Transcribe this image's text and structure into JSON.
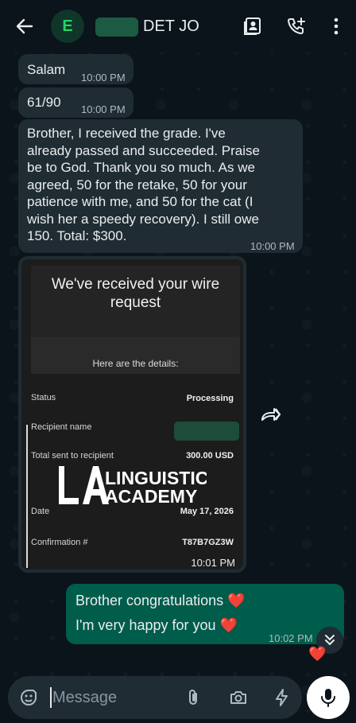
{
  "header": {
    "avatar_letter": "E",
    "contact_name": "DET JO",
    "back_icon": "arrow-left-icon",
    "icons": [
      "contact-card-icon",
      "add-call-icon",
      "more-vert-icon"
    ]
  },
  "messages": [
    {
      "text": "Salam",
      "time": "10:00 PM",
      "direction": "incoming"
    },
    {
      "text": "61/90",
      "time": "10:00 PM",
      "direction": "incoming"
    },
    {
      "lines": [
        "Brother, I received the grade. I've",
        "already passed and succeeded. Praise",
        "be to God. Thank you so much. As we",
        "agreed, 50 for the retake, 50 for your",
        "patience with me, and 50 for the cat (I",
        "wish her a speedy recovery). I still owe",
        "150. Total: $300."
      ],
      "time": "10:00 PM",
      "direction": "incoming"
    }
  ],
  "wire_receipt": {
    "title_line1": "We've received your wire",
    "title_line2": "request",
    "subtitle": "Here are the details:",
    "rows": [
      {
        "label": "Status",
        "value": "Processing"
      },
      {
        "label": "Recipient name",
        "value": ""
      },
      {
        "label": "Total sent to recipient",
        "value": "300.00 USD"
      },
      {
        "label": "Date",
        "value": "May 17, 2026"
      },
      {
        "label": "Confirmation #",
        "value": "T87B7GZ3W"
      }
    ],
    "time": "10:01 PM"
  },
  "watermark": {
    "logo_letters": "LA",
    "line1": "LINGUISTIC",
    "line2": "ACADEMY"
  },
  "outgoing": {
    "line1": "Brother congratulations",
    "line2": "I'm very happy for you",
    "heart": "❤️",
    "time": "10:02 PM"
  },
  "composer": {
    "placeholder": "Message",
    "icons": [
      "sticker-icon",
      "attach-icon",
      "camera-icon",
      "lightning-icon",
      "mic-icon"
    ]
  },
  "colors": {
    "background": "#0b141a",
    "incoming_bubble": "#202c33",
    "outgoing_bubble": "#005c4b",
    "accent": "#25d366"
  }
}
